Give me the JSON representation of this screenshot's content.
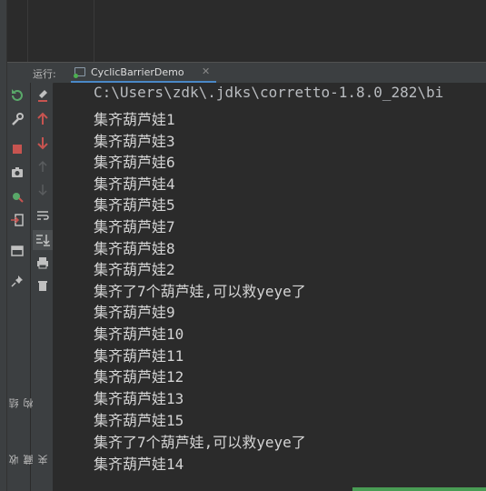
{
  "run_panel": {
    "run_label": "运行:",
    "tab_title": "CyclicBarrierDemo",
    "tab_close": "✕"
  },
  "side_tabs": {
    "structure": "结构",
    "favorites": "收藏夹"
  },
  "toolbar_icons": [
    "rerun-icon",
    "wrench-icon",
    "stop-icon",
    "camera-icon",
    "debug-icon",
    "login-icon",
    "layout-icon",
    "pin-icon",
    "clear-icon",
    "arrow-up-icon",
    "arrow-down-icon",
    "arrow-up-disabled-icon",
    "arrow-down-disabled-icon",
    "soft-wrap-icon",
    "scroll-end-icon",
    "print-icon",
    "trash-icon"
  ],
  "console": {
    "lines": [
      "C:\\Users\\zdk\\.jdks\\corretto-1.8.0_282\\bi",
      "集齐葫芦娃1",
      "集齐葫芦娃3",
      "集齐葫芦娃6",
      "集齐葫芦娃4",
      "集齐葫芦娃5",
      "集齐葫芦娃7",
      "集齐葫芦娃8",
      "集齐葫芦娃2",
      "集齐了7个葫芦娃,可以救yeye了",
      "集齐葫芦娃9",
      "集齐葫芦娃10",
      "集齐葫芦娃11",
      "集齐葫芦娃12",
      "集齐葫芦娃13",
      "集齐葫芦娃15",
      "集齐了7个葫芦娃,可以救yeye了",
      "集齐葫芦娃14"
    ]
  }
}
